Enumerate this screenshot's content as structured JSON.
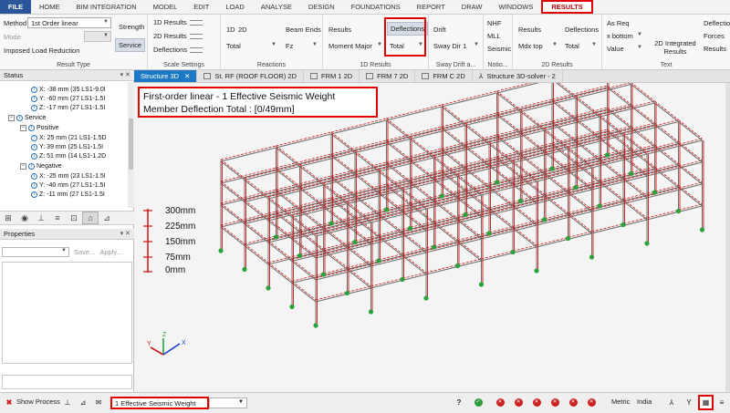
{
  "menu": {
    "items": [
      "FILE",
      "HOME",
      "BIM INTEGRATION",
      "MODEL",
      "EDIT",
      "LOAD",
      "ANALYSE",
      "DESIGN",
      "FOUNDATIONS",
      "REPORT",
      "DRAW",
      "WINDOWS",
      "RESULTS"
    ],
    "active": "RESULTS"
  },
  "ribbon": {
    "result_type": {
      "method_label": "Method",
      "method_value": "1st Order linear",
      "mode_label": "Mode",
      "imposed_label": "Imposed Load Reduction",
      "strength_label": "Strength",
      "service_label": "Service",
      "group_label": "Result Type"
    },
    "scale_settings": {
      "results_1d": "1D Results",
      "results_2d": "2D Results",
      "deflections": "Deflections",
      "group_label": "Scale Settings"
    },
    "reactions": {
      "btn_1d": "1D",
      "btn_2d": "2D",
      "total_value": "Total",
      "beam_ends": "Beam Ends",
      "fz_value": "Fz",
      "group_label": "Reactions"
    },
    "results_1d": {
      "results_label": "Results",
      "moment_value": "Moment Major",
      "deflections_label": "Deflections",
      "total_value": "Total",
      "group_label": "1D Results"
    },
    "sway": {
      "drift_label": "Drift",
      "sway_value": "Sway Dir 1",
      "group_label": "Sway Drift a..."
    },
    "notional": {
      "nhf": "NHF",
      "mll": "MLL",
      "seismic": "Seismic",
      "group_label": "Notio..."
    },
    "results_2d": {
      "results_label": "Results",
      "mdx_value": "Mdx top",
      "deflections_label": "Deflections",
      "total_value": "Total",
      "group_label": "2D Results"
    },
    "text": {
      "as_req": "As Req",
      "x_bottom": "x bottom",
      "value": "Value",
      "integrated": "2D Integrated Results",
      "deflection": "Deflection",
      "forces": "Forces",
      "results": "Results",
      "group_label": "Text"
    }
  },
  "tabs": [
    {
      "label": "Structure 3D",
      "active": true
    },
    {
      "label": "St. RF (ROOF FLOOR) 2D",
      "active": false
    },
    {
      "label": "FRM 1 2D",
      "active": false
    },
    {
      "label": "FRM 7 2D",
      "active": false
    },
    {
      "label": "FRM C 2D",
      "active": false
    },
    {
      "label": "Structure 3D-solver - 2",
      "active": false
    }
  ],
  "status_panel": {
    "title": "Status",
    "rows": [
      "X: -38 mm (35 LS1-9.0I",
      "Y: -60 mm (27 LS1-1.5I",
      "Z: -17 mm (27 LS1-1.5I",
      "Service",
      "Positive",
      "X: 25 mm (21 LS1-1.5D",
      "Y: 39 mm (25 LS1-1.5I",
      "Z: 51 mm (14 LS1-1.2D",
      "Negative",
      "X: -25 mm (23 LS1-1.5I",
      "Y: -40 mm (27 LS1-1.5I",
      "Z: -11 mm (27 LS1-1.5I"
    ]
  },
  "properties_panel": {
    "title": "Properties",
    "save_label": "Save...",
    "apply_label": "Apply..."
  },
  "viewport": {
    "caption_line1": "First-order linear - 1 Effective Seismic Weight",
    "caption_line2": "Member Deflection Total : [0/49mm]",
    "legend": [
      "300mm",
      "225mm",
      "150mm",
      "75mm",
      "0mm"
    ],
    "axes": {
      "x": "X",
      "y": "Y",
      "z": "Z"
    }
  },
  "statusbar": {
    "show_process": "Show Process",
    "loadcase": "1 Effective Seismic Weight",
    "units": "Metric",
    "region": "India"
  },
  "colors": {
    "accent": "#1e79c4",
    "highlight": "#e00000",
    "file_tab": "#2b579a",
    "member_red": "#d01515",
    "member_grey": "#6e6e6e",
    "support_green": "#2aa23a"
  }
}
